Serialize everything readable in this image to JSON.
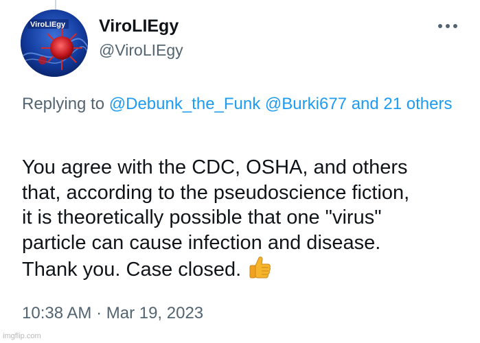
{
  "tweet": {
    "author": {
      "display_name": "ViroLIEgy",
      "handle": "@ViroLIEgy",
      "avatar_text": "ViroLIEgy"
    },
    "more_icon": "more-horizontal-icon",
    "replying_to": {
      "prefix": "Replying to ",
      "mentions": [
        "@Debunk_the_Funk",
        "@Burki677"
      ],
      "suffix": "and 21 others"
    },
    "body_lines": [
      "You agree with the CDC, OSHA, and others",
      "that, according to the pseudoscience fiction,",
      "it is theoretically possible that one \"virus\"",
      "particle can cause infection and disease.",
      "Thank you. Case closed."
    ],
    "emoji": "thumbs-up",
    "timestamp": "10:38 AM · Mar 19, 2023"
  },
  "watermark": "imgflip.com",
  "colors": {
    "link": "#1d9bf0",
    "secondary_text": "#536471",
    "primary_text": "#0f1419"
  }
}
